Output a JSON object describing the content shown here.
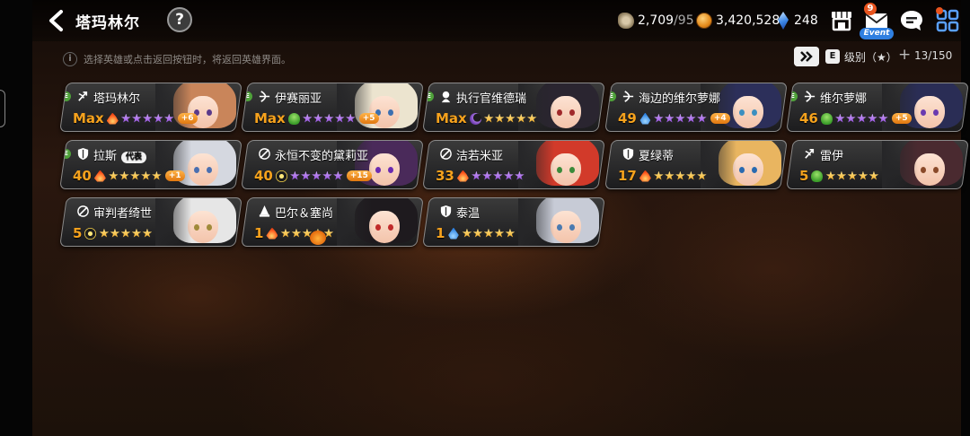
{
  "header": {
    "title": "塔玛林尔",
    "help_label": "?",
    "resources": [
      {
        "name": "key",
        "value": "2,709",
        "max": "/95"
      },
      {
        "name": "gold",
        "value": "3,420,528"
      },
      {
        "name": "crystal",
        "value": "248"
      }
    ],
    "mail_badge": "9",
    "event_label": "Event"
  },
  "info": {
    "hint": "选择英雄或点击返回按钮时，将返回英雄界面。",
    "info_icon": "i",
    "sort_label": "级别（★）",
    "sort_icon": "E",
    "count_plus": "+",
    "count": "13/150"
  },
  "heroes": [
    {
      "name": "塔玛林尔",
      "level": "Max",
      "element": "fire",
      "stars": 5,
      "star_color": "purple",
      "plus": "+6",
      "equipped": true,
      "equipped_mark": "E",
      "class_icon": "archer-icon",
      "hair": "#c9855a"
    },
    {
      "name": "伊赛丽亚",
      "level": "Max",
      "element": "wood",
      "stars": 5,
      "star_color": "purple",
      "plus": "+5",
      "equipped": true,
      "equipped_mark": "E",
      "class_icon": "bow-icon",
      "hair": "#ece4cf"
    },
    {
      "name": "执行官维德瑞",
      "level": "Max",
      "element": "dark",
      "stars": 5,
      "star_color": "gold",
      "equipped": true,
      "equipped_mark": "E",
      "class_icon": "assassin-icon",
      "hair": "#2a2530"
    },
    {
      "name": "海边的维尔萝娜",
      "level": "49",
      "element": "water",
      "stars": 5,
      "star_color": "purple",
      "plus": "+4",
      "equipped": true,
      "equipped_mark": "E",
      "class_icon": "bow-icon",
      "hair": "#2c2f5a"
    },
    {
      "name": "维尔萝娜",
      "level": "46",
      "element": "wood",
      "stars": 5,
      "star_color": "purple",
      "plus": "+5",
      "equipped": true,
      "equipped_mark": "E",
      "class_icon": "bow-icon",
      "hair": "#2a2d55"
    },
    {
      "name": "拉斯",
      "level": "40",
      "element": "fire",
      "stars": 5,
      "star_color": "gold",
      "plus": "+1",
      "equipped": true,
      "equipped_mark": "E",
      "representative": "代表",
      "class_icon": "knight-icon",
      "hair": "#d5d8e0"
    },
    {
      "name": "永恒不变的黛莉亚",
      "level": "40",
      "element": "light",
      "stars": 5,
      "star_color": "purple",
      "plus": "+15",
      "class_icon": "thief-icon",
      "hair": "#4a2a5a"
    },
    {
      "name": "洁若米亚",
      "level": "33",
      "element": "fire",
      "stars": 5,
      "star_color": "purple",
      "class_icon": "thief-icon",
      "hair": "#d23a2a"
    },
    {
      "name": "夏绿蒂",
      "level": "17",
      "element": "fire",
      "stars": 5,
      "star_color": "gold",
      "class_icon": "knight-icon",
      "hair": "#e9b560"
    },
    {
      "name": "雷伊",
      "level": "5",
      "element": "wood",
      "stars": 5,
      "star_color": "gold",
      "class_icon": "archer-icon",
      "hair": "#4a2a30"
    },
    {
      "name": "审判者绮世",
      "level": "5",
      "element": "light",
      "stars": 5,
      "star_color": "gold",
      "class_icon": "thief-icon",
      "hair": "#e6e6e6"
    },
    {
      "name": "巴尔＆塞尚",
      "level": "1",
      "element": "fire",
      "stars": 5,
      "star_color": "gold",
      "class_icon": "mage-icon",
      "hair": "#1e1a1e",
      "pumpkin": true
    },
    {
      "name": "泰温",
      "level": "1",
      "element": "water",
      "stars": 5,
      "star_color": "gold",
      "class_icon": "knight-icon",
      "hair": "#c7cbd6"
    }
  ]
}
